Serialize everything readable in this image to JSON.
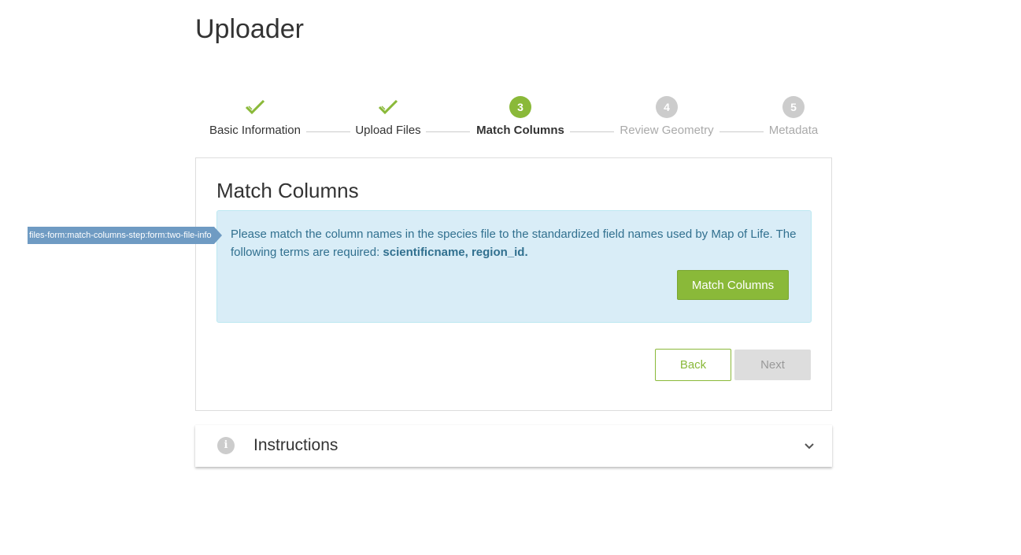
{
  "page": {
    "title": "Uploader"
  },
  "stepper": {
    "steps": [
      {
        "number": "1",
        "label": "Basic Information",
        "state": "done"
      },
      {
        "number": "2",
        "label": "Upload Files",
        "state": "done"
      },
      {
        "number": "3",
        "label": "Match Columns",
        "state": "active"
      },
      {
        "number": "4",
        "label": "Review Geometry",
        "state": "pending"
      },
      {
        "number": "5",
        "label": "Metadata",
        "state": "pending"
      }
    ]
  },
  "card": {
    "title": "Match Columns",
    "info": {
      "text": "Please match the column names in the species file to the standardized field names used by Map of Life. The following terms are required: ",
      "required_terms": "scientificname, region_id.",
      "button_label": "Match Columns"
    },
    "back_label": "Back",
    "next_label": "Next"
  },
  "instructions": {
    "title": "Instructions",
    "icon": "info-icon"
  },
  "debug_tag": {
    "text": "files-form:match-columns-step:form:two-file-info"
  },
  "colors": {
    "accent": "#8ab939",
    "pending": "#cccccc",
    "info_bg": "#d9edf7",
    "info_text": "#31708f",
    "debug_tag": "#6f9bc3"
  }
}
